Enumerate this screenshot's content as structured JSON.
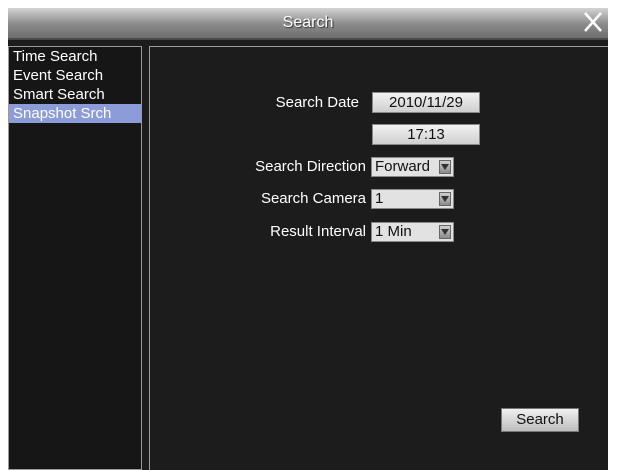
{
  "window": {
    "title": "Search"
  },
  "sidebar": {
    "items": [
      {
        "label": "Time Search"
      },
      {
        "label": "Event Search"
      },
      {
        "label": "Smart Search"
      },
      {
        "label": "Snapshot Srch"
      }
    ],
    "active_index": 3
  },
  "form": {
    "search_date_label": "Search Date",
    "search_date_value": "2010/11/29",
    "search_time_value": "17:13",
    "direction_label": "Search Direction",
    "direction_value": "Forward",
    "camera_label": "Search Camera",
    "camera_value": "1",
    "interval_label": "Result Interval",
    "interval_value": "1 Min"
  },
  "actions": {
    "search_label": "Search"
  },
  "colors": {
    "accent_highlight": "#8c9cd8",
    "background": "#1c1c1c"
  },
  "icons": {
    "close": "close-icon",
    "dropdown": "chevron-down-icon"
  }
}
